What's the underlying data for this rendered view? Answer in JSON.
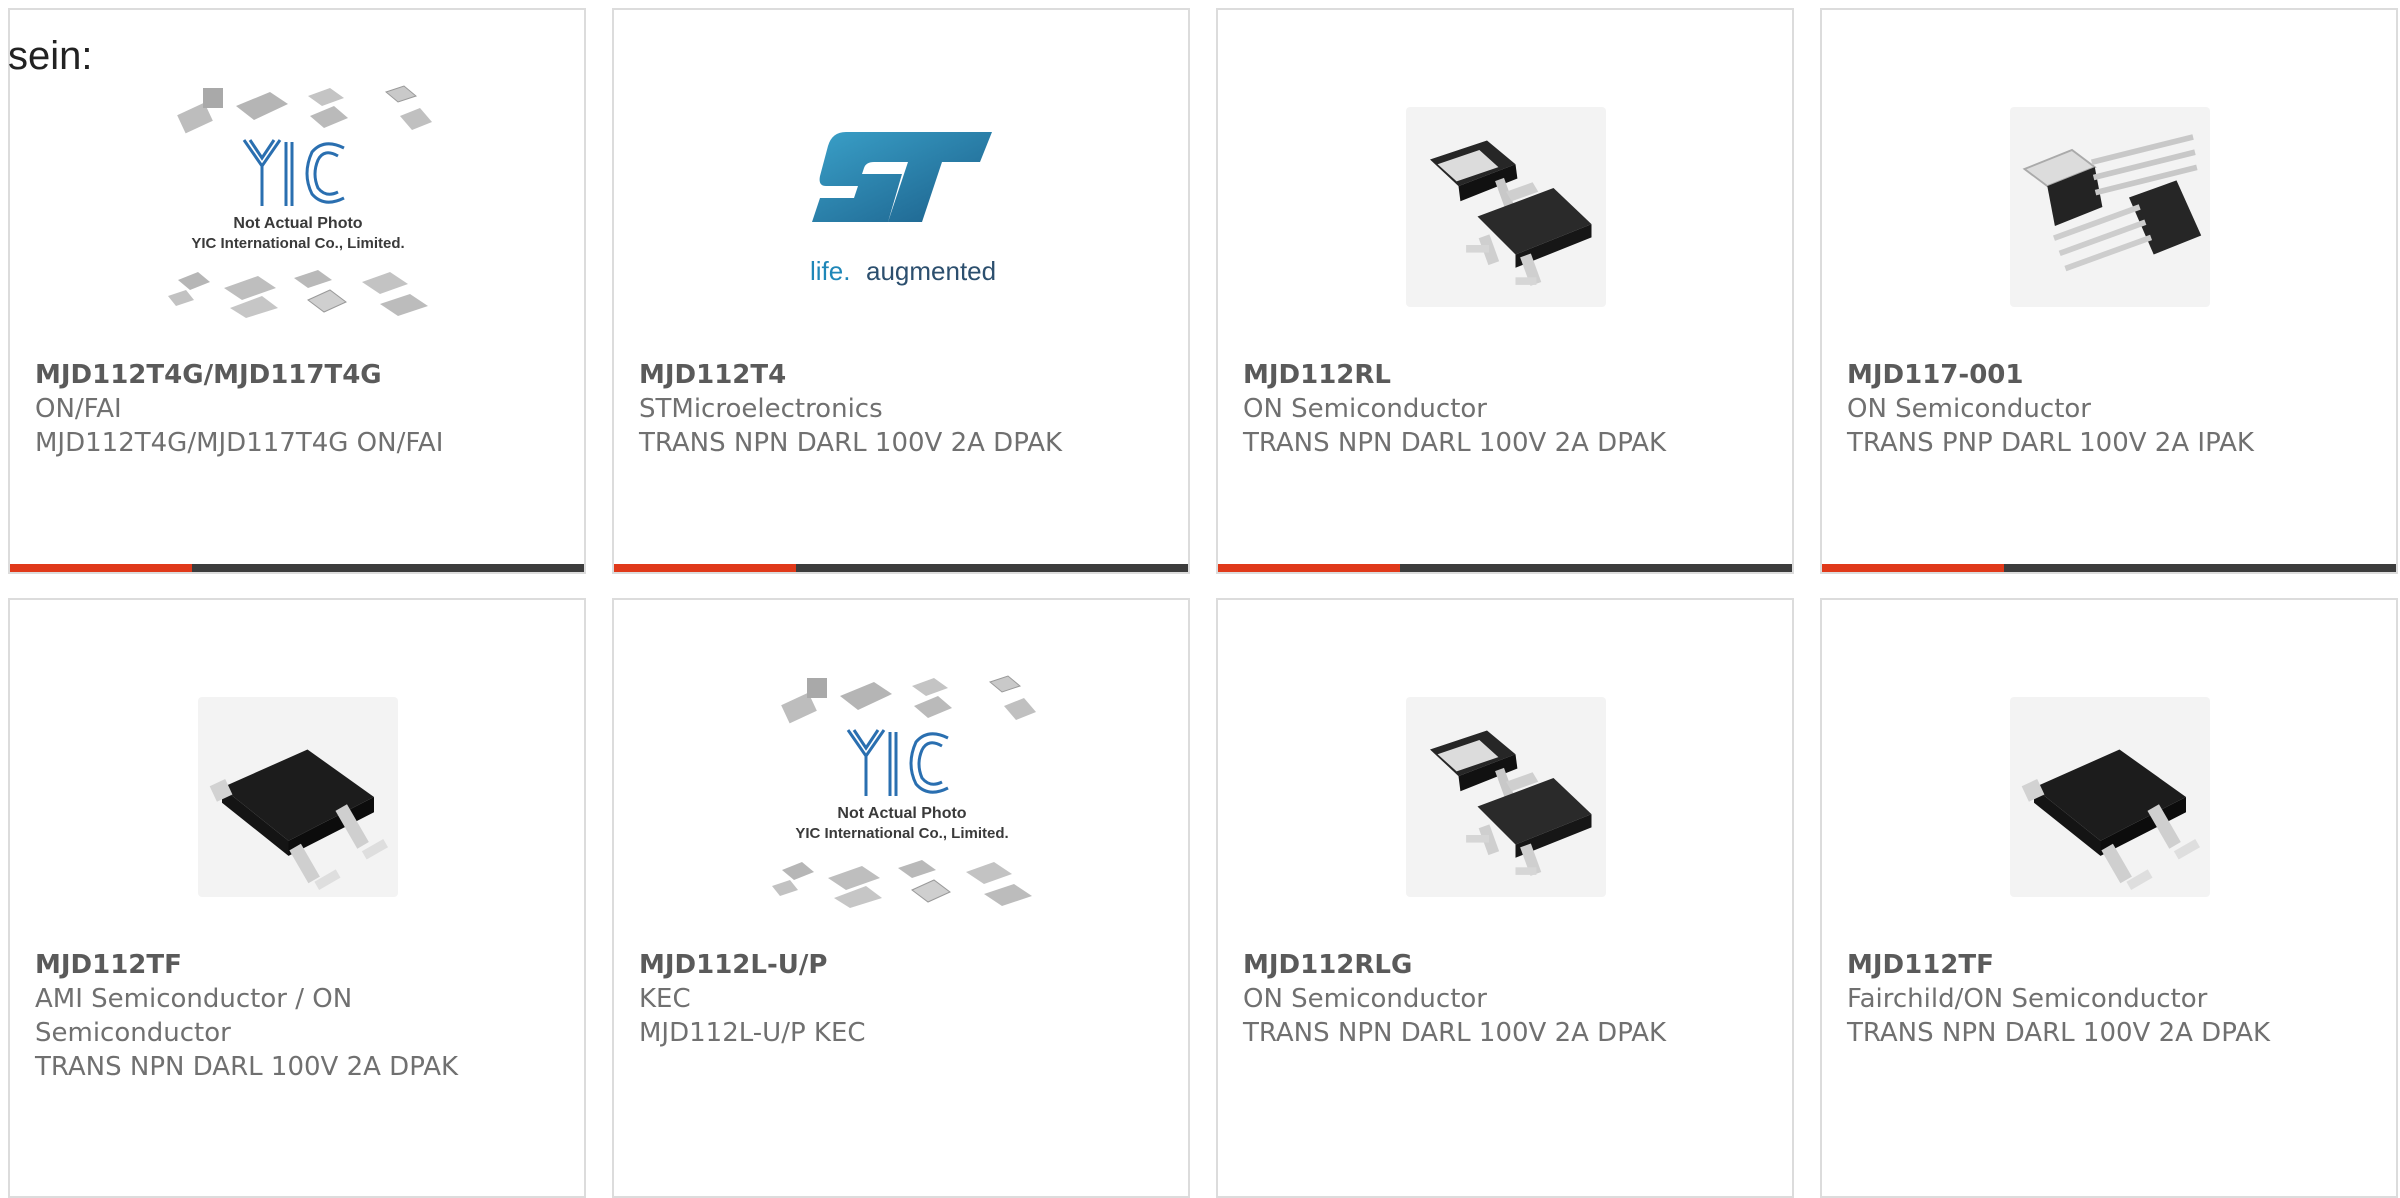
{
  "intro": "sein:",
  "colors": {
    "accent": "#e0391a",
    "bar": "#3c3c3c",
    "border": "#dcdcdc",
    "text": "#707070"
  },
  "products": [
    {
      "pn": "MJD112T4G/MJD117T4G",
      "mfr": "ON/FAI",
      "desc": "MJD112T4G/MJD117T4G ON/FAI",
      "image": "yic-placeholder-icon",
      "yic_caption_1": "Not Actual Photo",
      "yic_caption_2": "YIC International Co., Limited."
    },
    {
      "pn": "MJD112T4",
      "mfr": "STMicroelectronics",
      "desc": "TRANS NPN DARL 100V 2A DPAK",
      "image": "st-logo-icon",
      "logo_tagline_1": "life.",
      "logo_tagline_2": "augmented"
    },
    {
      "pn": "MJD112RL",
      "mfr": "ON Semiconductor",
      "desc": "TRANS NPN DARL 100V 2A DPAK",
      "image": "dpak-pair-icon"
    },
    {
      "pn": "MJD117-001",
      "mfr": "ON Semiconductor",
      "desc": "TRANS PNP DARL 100V 2A IPAK",
      "image": "ipak-pair-icon"
    },
    {
      "pn": "MJD112TF",
      "mfr": "AMI Semiconductor / ON Semiconductor",
      "desc": "TRANS NPN DARL 100V 2A DPAK",
      "image": "dpak-single-icon"
    },
    {
      "pn": "MJD112L-U/P",
      "mfr": "KEC",
      "desc": "MJD112L-U/P KEC",
      "image": "yic-placeholder-icon",
      "yic_caption_1": "Not Actual Photo",
      "yic_caption_2": "YIC International Co., Limited."
    },
    {
      "pn": "MJD112RLG",
      "mfr": "ON Semiconductor",
      "desc": "TRANS NPN DARL 100V 2A DPAK",
      "image": "dpak-pair-icon"
    },
    {
      "pn": "MJD112TF",
      "mfr": "Fairchild/ON Semiconductor",
      "desc": "TRANS NPN DARL 100V 2A DPAK",
      "image": "dpak-single-icon"
    }
  ]
}
